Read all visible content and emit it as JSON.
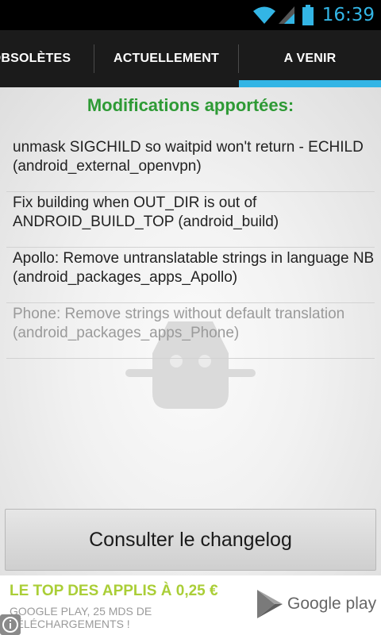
{
  "status_bar": {
    "time": "16:39",
    "icons": [
      "wifi-icon",
      "signal-icon",
      "battery-icon"
    ]
  },
  "tabs": [
    {
      "label": "OBSOLÈTES",
      "selected": false
    },
    {
      "label": "ACTUELLEMENT",
      "selected": false
    },
    {
      "label": "A VENIR",
      "selected": true
    }
  ],
  "content": {
    "title": "Modifications apportées:",
    "changes": [
      {
        "text": "unmask SIGCHILD so waitpid won't return - ECHILD (android_external_openvpn)"
      },
      {
        "text": "Fix building when OUT_DIR is out of ANDROID_BUILD_TOP (android_build)"
      },
      {
        "text": "Apollo: Remove untranslatable strings in language NB (android_packages_apps_Apollo)"
      },
      {
        "text": "Phone: Remove strings without default translation (android_packages_apps_Phone)"
      }
    ]
  },
  "changelog_button": "Consulter le changelog",
  "ad": {
    "headline": "LE TOP DES APPLIS À 0,25 €",
    "subtext": "GOOGLE PLAY, 25 MDS DE TÉLÉCHARGEMENTS !",
    "brand": "Google play"
  },
  "colors": {
    "accent": "#33b5e5",
    "title_green": "#2e9a35",
    "ad_green": "#aace37"
  }
}
